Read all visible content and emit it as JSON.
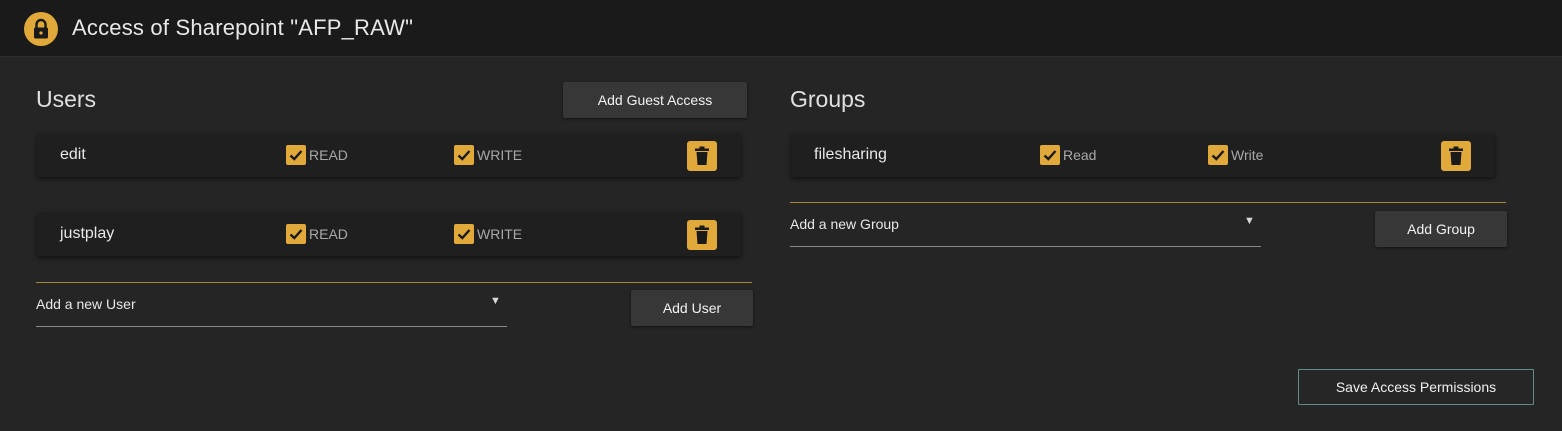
{
  "header": {
    "title": "Access of Sharepoint \"AFP_RAW\"",
    "icon": "lock-icon"
  },
  "users": {
    "title": "Users",
    "guest_button_label": "Add Guest Access",
    "rows": [
      {
        "name": "edit",
        "read_label": "READ",
        "read_checked": true,
        "write_label": "WRITE",
        "write_checked": true
      },
      {
        "name": "justplay",
        "read_label": "READ",
        "read_checked": true,
        "write_label": "WRITE",
        "write_checked": true
      }
    ],
    "add_select_value": "Add a new User",
    "add_button_label": "Add User"
  },
  "groups": {
    "title": "Groups",
    "rows": [
      {
        "name": "filesharing",
        "read_label": "Read",
        "read_checked": true,
        "write_label": "Write",
        "write_checked": true
      }
    ],
    "add_select_value": "Add a new Group",
    "add_button_label": "Add Group"
  },
  "save_button_label": "Save Access Permissions",
  "colors": {
    "accent": "#e0a93a",
    "background": "#252525",
    "header": "#1a1a1a",
    "save_border": "#5f8c8c"
  }
}
